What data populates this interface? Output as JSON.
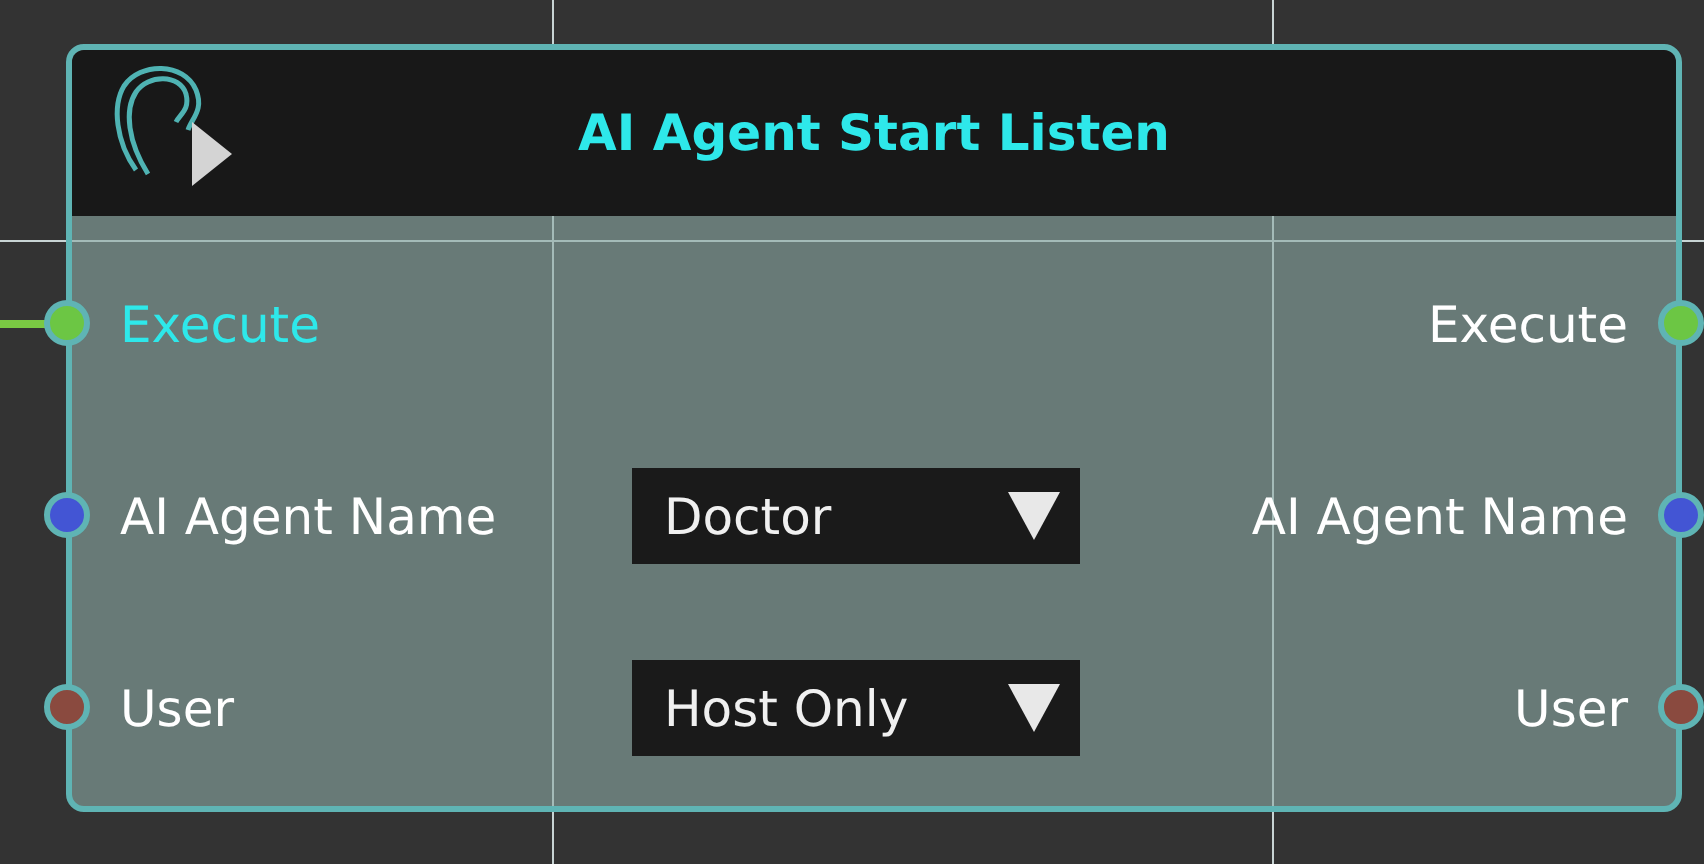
{
  "node": {
    "title": "AI Agent Start Listen",
    "rows": [
      {
        "input": {
          "label": "Execute",
          "color": "#6cc644",
          "connected": true
        },
        "output": {
          "label": "Execute",
          "color": "#6cc644"
        }
      },
      {
        "input": {
          "label": "AI Agent Name",
          "color": "#4355d4",
          "connected": false
        },
        "dropdown": {
          "value": "Doctor"
        },
        "output": {
          "label": "AI Agent Name",
          "color": "#4355d4"
        }
      },
      {
        "input": {
          "label": "User",
          "color": "#8a4a3f",
          "connected": false
        },
        "dropdown": {
          "value": "Host Only"
        },
        "output": {
          "label": "User",
          "color": "#8a4a3f"
        }
      }
    ]
  }
}
